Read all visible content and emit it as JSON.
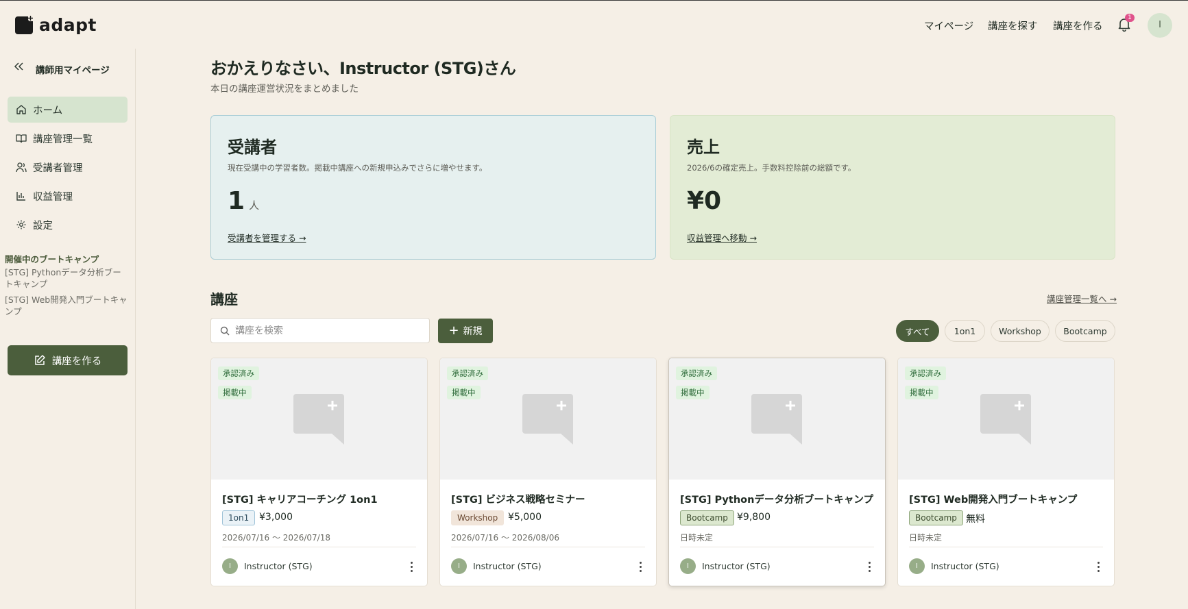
{
  "app": {
    "name": "adapt"
  },
  "topnav": {
    "mypage": "マイページ",
    "find": "講座を探す",
    "create": "講座を作る",
    "notification_count": "1",
    "avatar_initial": "I"
  },
  "sidebar": {
    "title": "講師用マイページ",
    "items": [
      {
        "label": "ホーム",
        "icon": "home-icon"
      },
      {
        "label": "講座管理一覧",
        "icon": "book-icon"
      },
      {
        "label": "受講者管理",
        "icon": "users-icon"
      },
      {
        "label": "収益管理",
        "icon": "chart-icon"
      },
      {
        "label": "設定",
        "icon": "gear-icon"
      }
    ],
    "bootcamp_title": "開催中のブートキャンプ",
    "bootcamps": [
      "[STG] Pythonデータ分析ブートキャンプ",
      "[STG] Web開発入門ブートキャンプ"
    ],
    "create_button": "講座を作る"
  },
  "main": {
    "welcome": "おかえりなさい、Instructor (STG)さん",
    "welcome_sub": "本日の講座運営状況をまとめました",
    "students": {
      "title": "受講者",
      "desc": "現在受講中の学習者数。掲載中講座への新規申込みでさらに増やせます。",
      "value": "1",
      "unit": "人",
      "link": "受講者を管理する →"
    },
    "sales": {
      "title": "売上",
      "desc": "2026/6の確定売上。手数料控除前の総額です。",
      "value": "¥0",
      "link": "収益管理へ移動 →"
    },
    "courses_title": "講座",
    "courses_link": "講座管理一覧へ →",
    "search_placeholder": "講座を検索",
    "new_button": "新規",
    "filters": [
      "すべて",
      "1on1",
      "Workshop",
      "Bootcamp"
    ]
  },
  "courses": [
    {
      "status1": "承認済み",
      "status2": "掲載中",
      "title": "[STG] キャリアコーチング 1on1",
      "type": "1on1",
      "price": "¥3,000",
      "date": "2026/07/16 〜 2026/07/18",
      "instructor": "Instructor (STG)",
      "initial": "I"
    },
    {
      "status1": "承認済み",
      "status2": "掲載中",
      "title": "[STG] ビジネス戦略セミナー",
      "type": "Workshop",
      "price": "¥5,000",
      "date": "2026/07/16 〜 2026/08/06",
      "instructor": "Instructor (STG)",
      "initial": "I"
    },
    {
      "status1": "承認済み",
      "status2": "掲載中",
      "title": "[STG] Pythonデータ分析ブートキャンプ",
      "type": "Bootcamp",
      "price": "¥9,800",
      "date": "日時未定",
      "instructor": "Instructor (STG)",
      "initial": "I"
    },
    {
      "status1": "承認済み",
      "status2": "掲載中",
      "title": "[STG] Web開発入門ブートキャンプ",
      "type": "Bootcamp",
      "price": "無料",
      "date": "日時未定",
      "instructor": "Instructor (STG)",
      "initial": "I"
    }
  ]
}
